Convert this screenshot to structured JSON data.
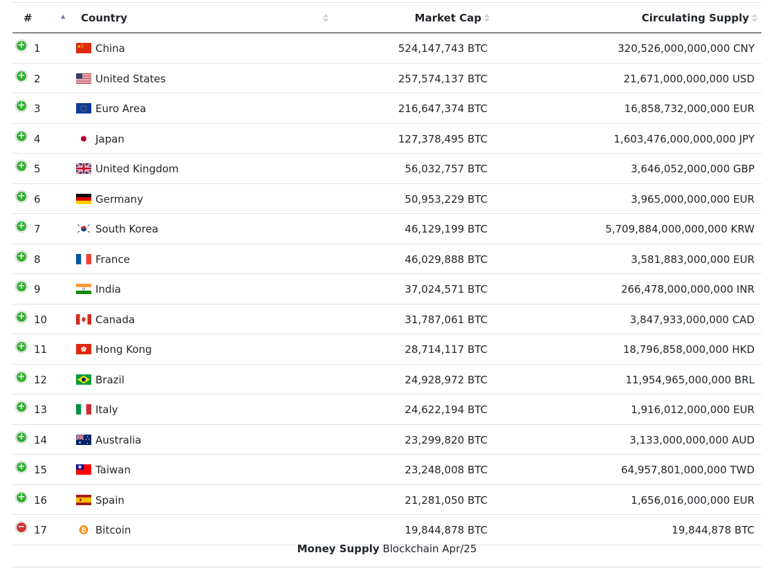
{
  "table": {
    "headers": {
      "rank": "#",
      "country": "Country",
      "market_cap": "Market Cap",
      "supply": "Circulating Supply"
    },
    "rows": [
      {
        "control": "expand",
        "rank": "1",
        "flag": "china-flag-icon",
        "name": "China",
        "market_cap": "524,147,743 BTC",
        "supply": "320,526,000,000,000 CNY"
      },
      {
        "control": "expand",
        "rank": "2",
        "flag": "united-states-flag-icon",
        "name": "United States",
        "market_cap": "257,574,137 BTC",
        "supply": "21,671,000,000,000 USD"
      },
      {
        "control": "expand",
        "rank": "3",
        "flag": "euro-area-flag-icon",
        "name": "Euro Area",
        "market_cap": "216,647,374 BTC",
        "supply": "16,858,732,000,000 EUR"
      },
      {
        "control": "expand",
        "rank": "4",
        "flag": "japan-flag-icon",
        "name": "Japan",
        "market_cap": "127,378,495 BTC",
        "supply": "1,603,476,000,000,000 JPY"
      },
      {
        "control": "expand",
        "rank": "5",
        "flag": "united-kingdom-flag-icon",
        "name": "United Kingdom",
        "market_cap": "56,032,757 BTC",
        "supply": "3,646,052,000,000 GBP"
      },
      {
        "control": "expand",
        "rank": "6",
        "flag": "germany-flag-icon",
        "name": "Germany",
        "market_cap": "50,953,229 BTC",
        "supply": "3,965,000,000,000 EUR"
      },
      {
        "control": "expand",
        "rank": "7",
        "flag": "south-korea-flag-icon",
        "name": "South Korea",
        "market_cap": "46,129,199 BTC",
        "supply": "5,709,884,000,000,000 KRW"
      },
      {
        "control": "expand",
        "rank": "8",
        "flag": "france-flag-icon",
        "name": "France",
        "market_cap": "46,029,888 BTC",
        "supply": "3,581,883,000,000 EUR"
      },
      {
        "control": "expand",
        "rank": "9",
        "flag": "india-flag-icon",
        "name": "India",
        "market_cap": "37,024,571 BTC",
        "supply": "266,478,000,000,000 INR"
      },
      {
        "control": "expand",
        "rank": "10",
        "flag": "canada-flag-icon",
        "name": "Canada",
        "market_cap": "31,787,061 BTC",
        "supply": "3,847,933,000,000 CAD"
      },
      {
        "control": "expand",
        "rank": "11",
        "flag": "hong-kong-flag-icon",
        "name": "Hong Kong",
        "market_cap": "28,714,117 BTC",
        "supply": "18,796,858,000,000 HKD"
      },
      {
        "control": "expand",
        "rank": "12",
        "flag": "brazil-flag-icon",
        "name": "Brazil",
        "market_cap": "24,928,972 BTC",
        "supply": "11,954,965,000,000 BRL"
      },
      {
        "control": "expand",
        "rank": "13",
        "flag": "italy-flag-icon",
        "name": "Italy",
        "market_cap": "24,622,194 BTC",
        "supply": "1,916,012,000,000 EUR"
      },
      {
        "control": "expand",
        "rank": "14",
        "flag": "australia-flag-icon",
        "name": "Australia",
        "market_cap": "23,299,820 BTC",
        "supply": "3,133,000,000,000 AUD"
      },
      {
        "control": "expand",
        "rank": "15",
        "flag": "taiwan-flag-icon",
        "name": "Taiwan",
        "market_cap": "23,248,008 BTC",
        "supply": "64,957,801,000,000 TWD"
      },
      {
        "control": "expand",
        "rank": "16",
        "flag": "spain-flag-icon",
        "name": "Spain",
        "market_cap": "21,281,050 BTC",
        "supply": "1,656,016,000,000 EUR"
      },
      {
        "control": "collapse",
        "rank": "17",
        "flag": "bitcoin-icon",
        "name": "Bitcoin",
        "market_cap": "19,844,878 BTC",
        "supply": "19,844,878 BTC"
      }
    ],
    "footer": {
      "label": "Money Supply",
      "text": "Blockchain Apr/25"
    }
  },
  "colors": {
    "expand_button": "#31b131",
    "collapse_button": "#d33333",
    "sort_active": "#6b7bb5",
    "row_divider": "#dee2e6"
  }
}
